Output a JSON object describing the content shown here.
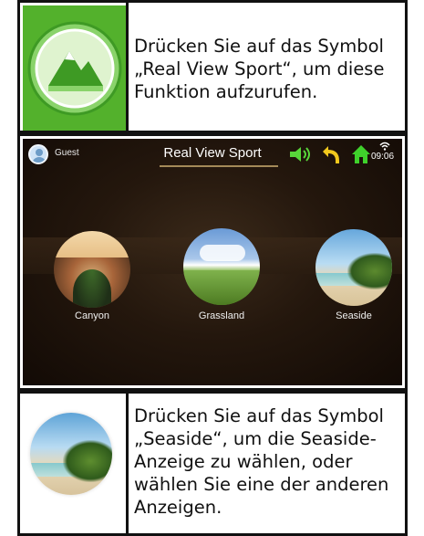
{
  "row1": {
    "icon": "real-view-sport-icon",
    "text_lines": [
      "Drücken Sie auf das Symbol",
      "„Real View Sport“, um diese",
      "Funktion aufzurufen."
    ]
  },
  "screen": {
    "user": "Guest",
    "title": "Real View Sport",
    "time": "09:06",
    "icons": [
      "speaker-icon",
      "back-arrow-icon",
      "home-icon",
      "wifi-icon"
    ],
    "scenes": [
      {
        "label": "Canyon",
        "icon": "canyon-scene-thumbnail"
      },
      {
        "label": "Grassland",
        "icon": "grassland-scene-thumbnail"
      },
      {
        "label": "Seaside",
        "icon": "seaside-scene-thumbnail"
      }
    ]
  },
  "row3": {
    "icon": "seaside-scene-thumbnail",
    "text_lines": [
      "Drücken Sie auf das Symbol",
      "„Seaside“, um die Seaside-",
      "Anzeige zu wählen, oder",
      "wählen Sie eine der anderen",
      "Anzeigen."
    ]
  },
  "colors": {
    "green_box": "#53b12c",
    "icon_green": "#3e9a24",
    "home_green": "#3fd12b",
    "speaker_green": "#58d63a",
    "back_yellow": "#f2c81d",
    "border": "#111111"
  }
}
